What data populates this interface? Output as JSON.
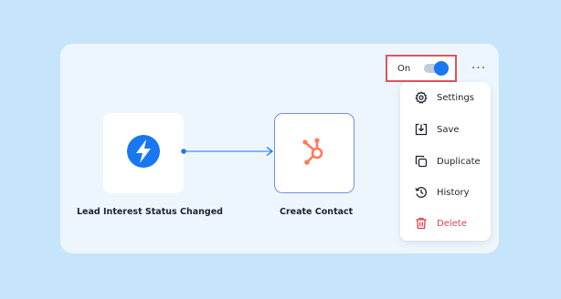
{
  "toggle": {
    "label": "On",
    "enabled": true,
    "accent": "#1877f2",
    "highlight": "#e05260"
  },
  "more_menu": {
    "icon": "more-horizontal-icon",
    "glyph": "···"
  },
  "menu": {
    "items": [
      {
        "label": "Settings",
        "icon": "gear-icon"
      },
      {
        "label": "Save",
        "icon": "save-icon"
      },
      {
        "label": "Duplicate",
        "icon": "duplicate-icon"
      },
      {
        "label": "History",
        "icon": "history-icon"
      },
      {
        "label": "Delete",
        "icon": "trash-icon",
        "color": "#e0424b"
      }
    ]
  },
  "workflow": {
    "trigger": {
      "label": "Lead Interest Status Changed",
      "icon": "lightning-bolt-icon",
      "color": "#1877f2"
    },
    "action": {
      "label": "Create Contact",
      "icon": "hubspot-icon",
      "color": "#ff7a59"
    }
  }
}
